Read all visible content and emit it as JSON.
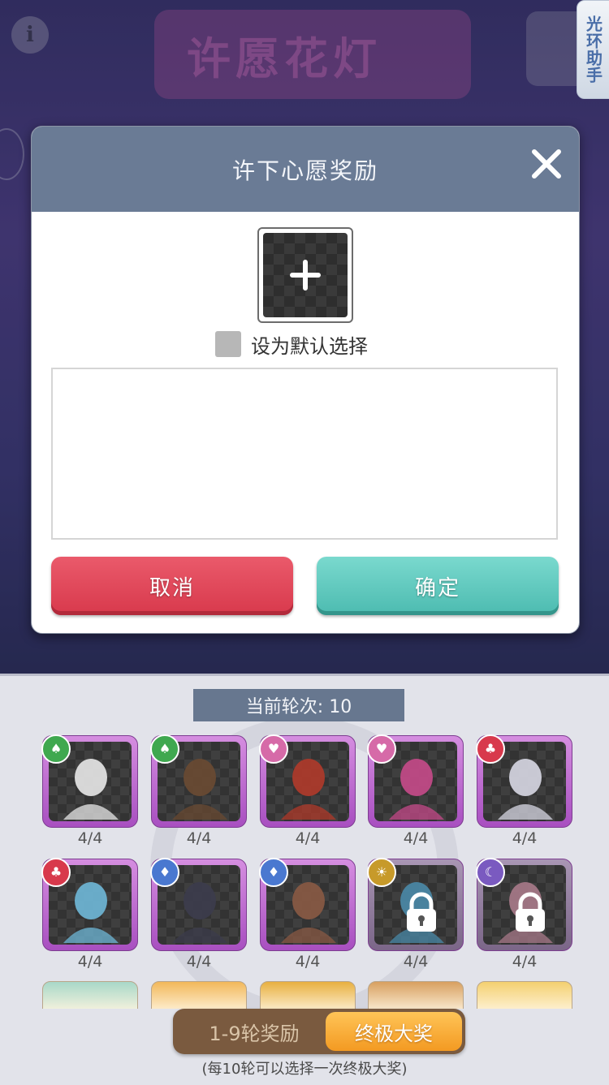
{
  "background": {
    "banner_text": "许愿花灯",
    "info_symbol": "i"
  },
  "assistant_tab": {
    "label": "光环助手"
  },
  "modal": {
    "title": "许下心愿奖励",
    "default_checkbox_label": "设为默认选择",
    "cancel_label": "取消",
    "confirm_label": "确定"
  },
  "panel": {
    "round_label": "当前轮次: 10",
    "heroes": [
      {
        "suit": "spade",
        "suit_color": "#3fa84f",
        "count": "4/4",
        "locked": false,
        "hue": "#e8e8e8"
      },
      {
        "suit": "spade",
        "suit_color": "#3fa84f",
        "count": "4/4",
        "locked": false,
        "hue": "#6a4a32"
      },
      {
        "suit": "heart",
        "suit_color": "#d66aa8",
        "count": "4/4",
        "locked": false,
        "hue": "#b03a2a"
      },
      {
        "suit": "heart",
        "suit_color": "#d66aa8",
        "count": "4/4",
        "locked": false,
        "hue": "#c64a8a"
      },
      {
        "suit": "club",
        "suit_color": "#d8394c",
        "count": "4/4",
        "locked": false,
        "hue": "#d8d8e4"
      },
      {
        "suit": "club",
        "suit_color": "#d8394c",
        "count": "4/4",
        "locked": false,
        "hue": "#6fb8d8"
      },
      {
        "suit": "diamond",
        "suit_color": "#4a78d0",
        "count": "4/4",
        "locked": false,
        "hue": "#3c3c4c"
      },
      {
        "suit": "diamond",
        "suit_color": "#4a78d0",
        "count": "4/4",
        "locked": false,
        "hue": "#8a5a44"
      },
      {
        "suit": "sun",
        "suit_color": "#c79a2a",
        "count": "4/4",
        "locked": true,
        "hue": "#4a8aa8"
      },
      {
        "suit": "moon",
        "suit_color": "#7a5ac0",
        "count": "4/4",
        "locked": true,
        "hue": "#a87a8a"
      }
    ],
    "tabs": {
      "rounds_label": "1-9轮奖励",
      "grand_label": "终极大奖"
    },
    "footnote": "(每10轮可以选择一次终极大奖)"
  }
}
